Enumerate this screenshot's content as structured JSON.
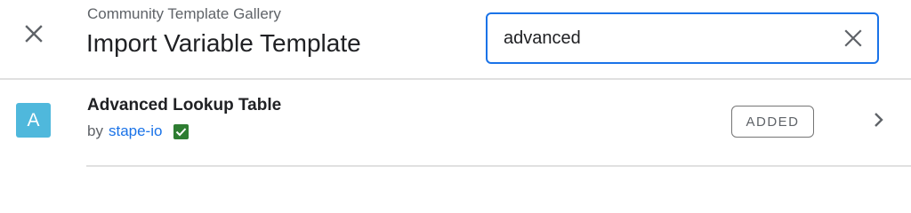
{
  "header": {
    "subtitle": "Community Template Gallery",
    "title": "Import Variable Template",
    "close_icon": "close-icon"
  },
  "search": {
    "value": "advanced",
    "clear_icon": "close-icon"
  },
  "results": [
    {
      "avatar_letter": "A",
      "title": "Advanced Lookup Table",
      "by_label": "by",
      "author": "stape-io",
      "verified_icon": "verified-check-icon",
      "status": "ADDED",
      "chevron_icon": "chevron-right-icon"
    }
  ],
  "colors": {
    "accent": "#1a73e8",
    "avatar_bg": "#4fb8dc",
    "verified": "#2e7d32"
  }
}
